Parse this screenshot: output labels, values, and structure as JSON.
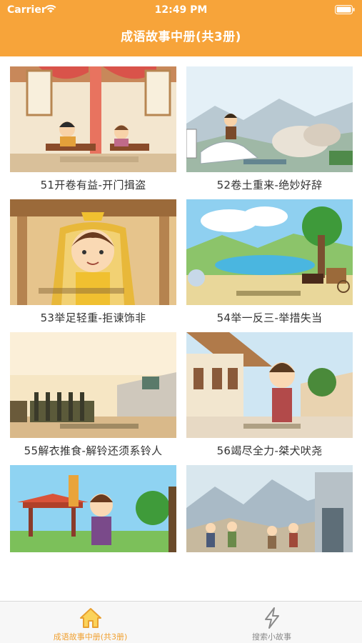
{
  "status_bar": {
    "carrier": "Carrier",
    "time": "12:49 PM"
  },
  "nav": {
    "title": "成语故事中册(共3册)"
  },
  "stories": [
    {
      "caption": "51开卷有益-开门揖盗"
    },
    {
      "caption": "52卷土重来-绝妙好辞"
    },
    {
      "caption": "53举足轻重-拒谏饰非"
    },
    {
      "caption": "54举一反三-举措失当"
    },
    {
      "caption": "55解衣推食-解铃还须系铃人"
    },
    {
      "caption": "56竭尽全力-桀犬吠尧"
    },
    {
      "caption": ""
    },
    {
      "caption": ""
    }
  ],
  "tabs": [
    {
      "label": "成语故事中册(共3册)",
      "icon": "home-icon",
      "active": true
    },
    {
      "label": "搜索小故事",
      "icon": "lightning-icon",
      "active": false
    }
  ],
  "colors": {
    "accent": "#F7A43A",
    "tab_active": "#F0A030",
    "tab_inactive": "#8A8A8A"
  }
}
